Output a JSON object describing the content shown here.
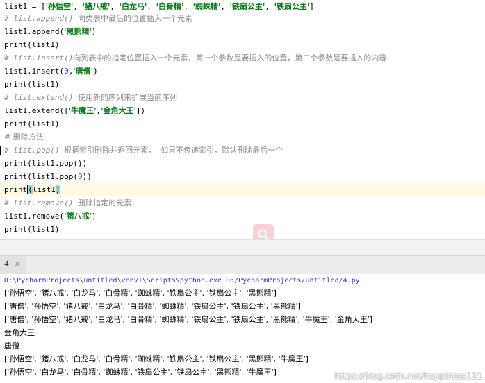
{
  "editor": {
    "lines": [
      {
        "kind": "assign",
        "code_prefix": "list1 = [",
        "items": [
          "'孙悟空'",
          "'猪八戒'",
          "'白龙马'",
          "'白骨精'",
          "'蜘蛛精'",
          "'铁扇公主'",
          "'铁扇公主'"
        ],
        "code_suffix": "]"
      },
      {
        "kind": "comment",
        "code": "# list.append()",
        "zh": "向类表中最后的位置插入一个元素"
      },
      {
        "kind": "call",
        "code_prefix": "list1.append(",
        "arg": "'黑熊精'",
        "code_suffix": ")"
      },
      {
        "kind": "plain",
        "code": "print(list1)"
      },
      {
        "kind": "comment",
        "code": "# list.insert()",
        "zh": "向列表中的指定位置插入一个元素，第一个参数是要插入的位置，第二个参数是要插入的内容"
      },
      {
        "kind": "insert",
        "code_prefix": "list1.insert(",
        "num": "0",
        "sep": ",",
        "arg": "'唐僧'",
        "code_suffix": ")"
      },
      {
        "kind": "plain",
        "code": "print(list1)"
      },
      {
        "kind": "comment",
        "code": "# list.extend()",
        "zh": "使用新的序列来扩展当前序列"
      },
      {
        "kind": "extend",
        "code_prefix": "list1.extend([",
        "items": [
          "'牛魔王'",
          "'金角大王'"
        ],
        "code_suffix": "])"
      },
      {
        "kind": "plain",
        "code": "print(list1)"
      },
      {
        "kind": "zhcomment",
        "code": "# 删除方法"
      },
      {
        "kind": "comment",
        "code": "# list.pop()",
        "zh": "根据索引删除并返回元素，  如果不传递索引，默认删除最后一个"
      },
      {
        "kind": "plain",
        "code": "print(list1.pop())"
      },
      {
        "kind": "popnum",
        "code_prefix": "print(list1.pop(",
        "num": "0",
        "code_suffix": "))"
      },
      {
        "kind": "caretline",
        "pre": "print",
        "open": "(",
        "mid": "list1",
        "close": ")"
      },
      {
        "kind": "comment",
        "code": "# list.remove()",
        "zh": "删除指定的元素"
      },
      {
        "kind": "call",
        "code_prefix": "list1.remove(",
        "arg": "'猪八戒'",
        "code_suffix": ")"
      },
      {
        "kind": "plain",
        "code": "print(list1)"
      }
    ]
  },
  "run_tab": {
    "label": "4",
    "close": "×"
  },
  "console": {
    "command": "D:\\PycharmProjects\\untitled\\venv1\\Scripts\\python.exe D:/PycharmProjects/untitled/4.py",
    "outputs": [
      "['孙悟空', '猪八戒', '白龙马', '白骨精', '蜘蛛精', '铁扇公主', '铁扇公主', '黑熊精']",
      "['唐僧', '孙悟空', '猪八戒', '白龙马', '白骨精', '蜘蛛精', '铁扇公主', '铁扇公主', '黑熊精']",
      "['唐僧', '孙悟空', '猪八戒', '白龙马', '白骨精', '蜘蛛精', '铁扇公主', '铁扇公主', '黑熊精', '牛魔王', '金角大王']",
      "金角大王",
      "唐僧",
      "['孙悟空', '猪八戒', '白龙马', '白骨精', '蜘蛛精', '铁扇公主', '铁扇公主', '黑熊精', '牛魔王']",
      "['孙悟空', '白龙马', '白骨精', '蜘蛛精', '铁扇公主', '铁扇公主', '黑熊精', '牛魔王']"
    ],
    "watermark": "https://blog.csdn.net/happiness121"
  },
  "colors": {
    "string": "#067d17",
    "number": "#1750eb",
    "comment": "#8c8c8c",
    "line_highlight": "#fffae3",
    "path": "#2f3ad0"
  },
  "icons": {
    "watermark_logo": "search-icon"
  }
}
